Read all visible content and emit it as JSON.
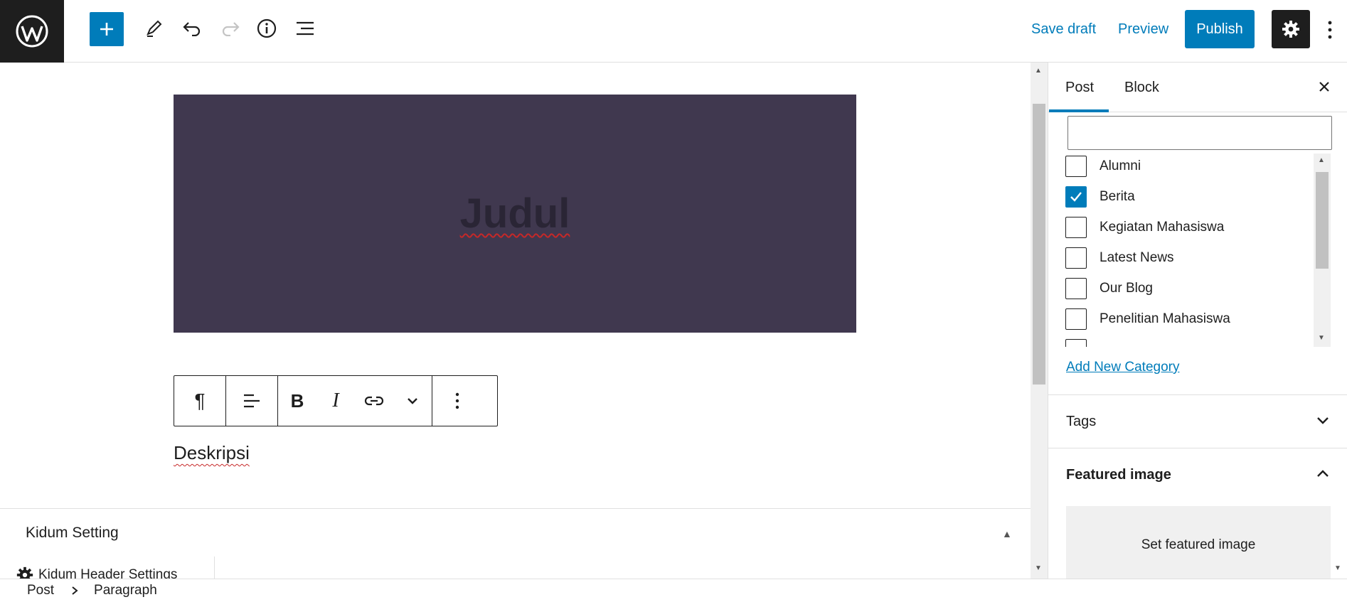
{
  "topbar": {
    "save_draft": "Save draft",
    "preview": "Preview",
    "publish": "Publish",
    "icons": [
      "wordpress-logo",
      "plus-icon",
      "pencil-icon",
      "undo-icon",
      "redo-icon",
      "info-icon",
      "list-view-icon",
      "gear-icon",
      "more-vertical-icon"
    ]
  },
  "editor": {
    "cover_title": "Judul",
    "paragraph": "Deskripsi",
    "block_toolbar_icons": [
      "pilcrow-icon",
      "align-left-icon",
      "bold-icon",
      "italic-icon",
      "link-icon",
      "chevron-down-icon",
      "more-vertical-icon"
    ]
  },
  "meta_box": {
    "title": "Kidum Setting",
    "subsection": "Kidum Header Settings"
  },
  "sidebar": {
    "tabs": [
      "Post",
      "Block"
    ],
    "active_tab": "Post",
    "categories": [
      {
        "label": "Alumni",
        "checked": false
      },
      {
        "label": "Berita",
        "checked": true
      },
      {
        "label": "Kegiatan Mahasiswa",
        "checked": false
      },
      {
        "label": "Latest News",
        "checked": false
      },
      {
        "label": "Our Blog",
        "checked": false
      },
      {
        "label": "Penelitian Mahasiswa",
        "checked": false
      }
    ],
    "add_new_category": "Add New Category",
    "tags_title": "Tags",
    "featured_title": "Featured image",
    "set_featured": "Set featured image"
  },
  "footer": {
    "crumbs": [
      "Post",
      "Paragraph"
    ]
  },
  "colors": {
    "accent": "#007cba",
    "cover_bg": "#40384f",
    "dark": "#1e1e1e"
  }
}
